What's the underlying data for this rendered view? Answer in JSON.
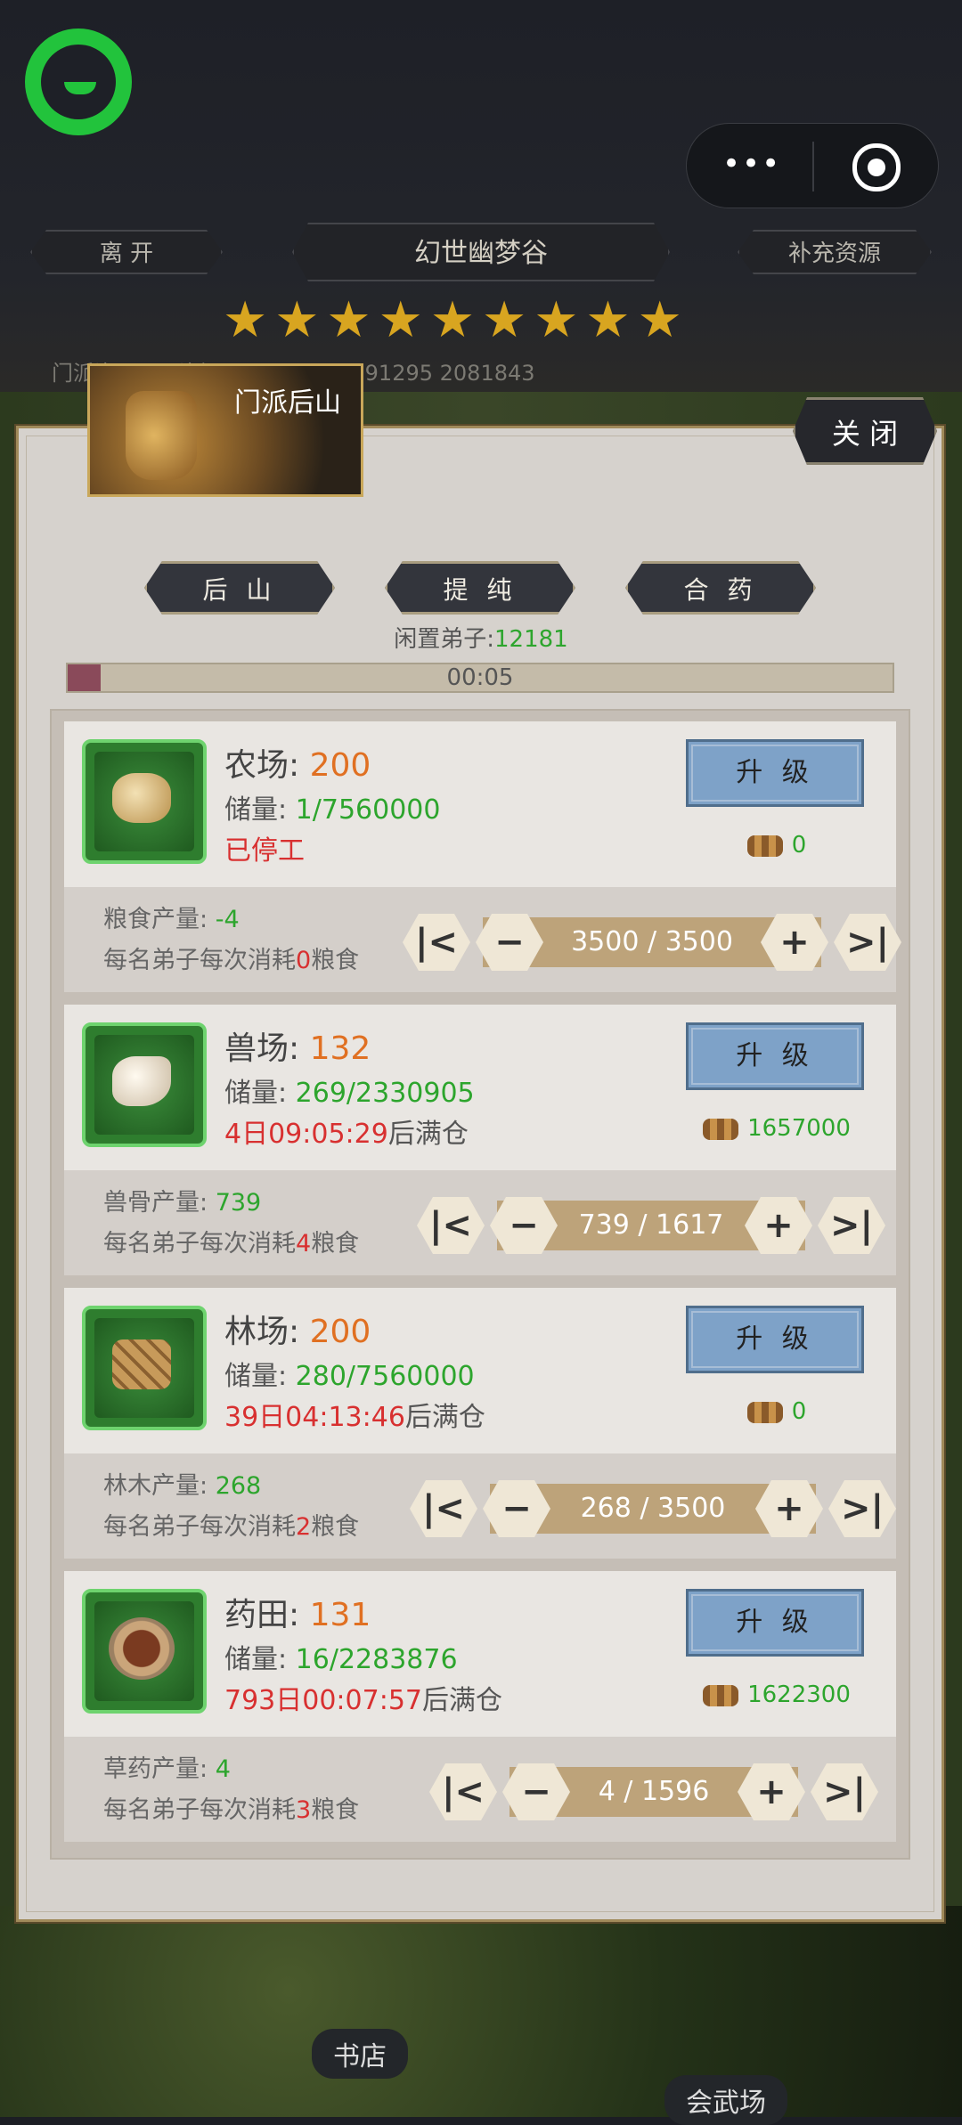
{
  "header": {
    "leave": "离 开",
    "title": "幻世幽梦谷",
    "supplement": "补充资源",
    "stars": "★★★★★★★★★",
    "resources": "门派资 …   … 资源: 4667428      3791295      2081843"
  },
  "capsule": {
    "more": "•••"
  },
  "panel": {
    "thumb_title": "门派后山",
    "close": "关 闭",
    "tabs": [
      "后 山",
      "提 纯",
      "合 药"
    ],
    "idle_label": "闲置弟子:",
    "idle_value": "12181",
    "progress": 0.04,
    "timer": "00:05"
  },
  "cards": [
    {
      "name": "农场:",
      "level": "200",
      "stock_label": "储量:",
      "stock": "1/7560000",
      "status_red": "已停工",
      "status_rest": "",
      "upgrade": "升 级",
      "cost": "0",
      "prod_label": "粮食产量:",
      "prod": "-4",
      "cons_a": "每名弟子每次消耗",
      "cons_n": "0",
      "cons_b": "粮食",
      "value": "3500 / 3500"
    },
    {
      "name": "兽场:",
      "level": "132",
      "stock_label": "储量:",
      "stock": "269/2330905",
      "status_red": "4日09:05:29",
      "status_rest": "后满仓",
      "upgrade": "升 级",
      "cost": "1657000",
      "prod_label": "兽骨产量:",
      "prod": "739",
      "cons_a": "每名弟子每次消耗",
      "cons_n": "4",
      "cons_b": "粮食",
      "value": "739 / 1617"
    },
    {
      "name": "林场:",
      "level": "200",
      "stock_label": "储量:",
      "stock": "280/7560000",
      "status_red": "39日04:13:46",
      "status_rest": "后满仓",
      "upgrade": "升 级",
      "cost": "0",
      "prod_label": "林木产量:",
      "prod": "268",
      "cons_a": "每名弟子每次消耗",
      "cons_n": "2",
      "cons_b": "粮食",
      "value": "268 / 3500"
    },
    {
      "name": "药田:",
      "level": "131",
      "stock_label": "储量:",
      "stock": "16/2283876",
      "status_red": "793日00:07:57",
      "status_rest": "后满仓",
      "upgrade": "升 级",
      "cost": "1622300",
      "prod_label": "草药产量:",
      "prod": "4",
      "cons_a": "每名弟子每次消耗",
      "cons_n": "3",
      "cons_b": "粮食",
      "value": "4 / 1596"
    }
  ],
  "controls": {
    "first": "|<",
    "minus": "−",
    "plus": "+",
    "last": ">|"
  },
  "map": {
    "bookstore": "书店",
    "arena": "会武场"
  },
  "colors": {
    "green": "#2da52d",
    "red": "#d83030",
    "orange": "#e07022",
    "button_blue": "#7ea2c8"
  },
  "icons": [
    "wechat-logo-icon",
    "more-dots-icon",
    "target-icon",
    "star-icon",
    "grain-sack-icon",
    "beast-bone-icon",
    "wood-logs-icon",
    "herb-bowl-icon",
    "logs-cost-icon"
  ]
}
